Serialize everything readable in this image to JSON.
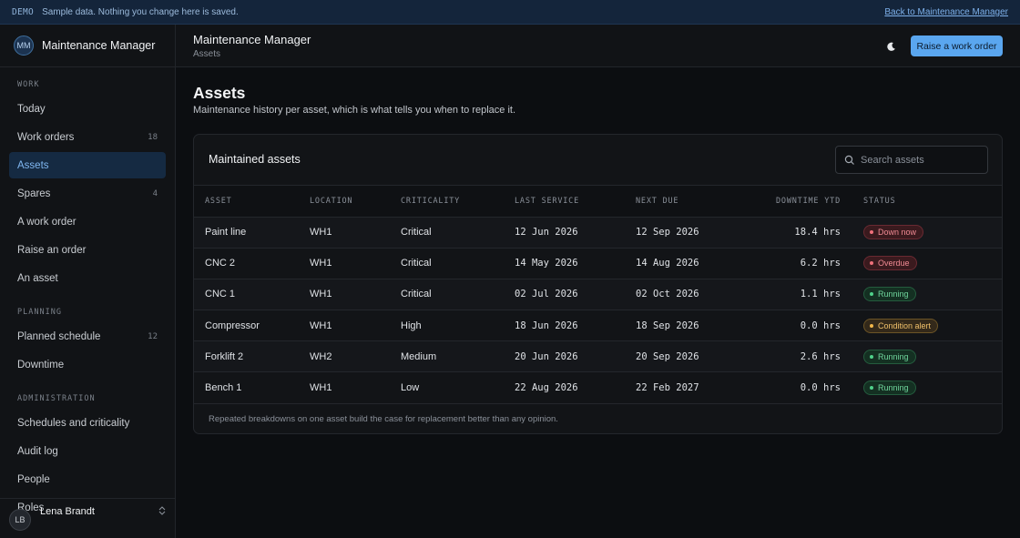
{
  "banner": {
    "tag": "DEMO",
    "message": "Sample data. Nothing you change here is saved.",
    "back_link": "Back to Maintenance Manager"
  },
  "brand": {
    "initials": "MM",
    "name": "Maintenance Manager"
  },
  "sidebar": {
    "sections": [
      {
        "title": "WORK",
        "items": [
          {
            "label": "Today",
            "count": ""
          },
          {
            "label": "Work orders",
            "count": "18"
          },
          {
            "label": "Assets",
            "count": "",
            "active": true
          },
          {
            "label": "Spares",
            "count": "4"
          },
          {
            "label": "A work order",
            "count": ""
          },
          {
            "label": "Raise an order",
            "count": ""
          },
          {
            "label": "An asset",
            "count": ""
          }
        ]
      },
      {
        "title": "PLANNING",
        "items": [
          {
            "label": "Planned schedule",
            "count": "12"
          },
          {
            "label": "Downtime",
            "count": ""
          }
        ]
      },
      {
        "title": "ADMINISTRATION",
        "items": [
          {
            "label": "Schedules and criticality",
            "count": ""
          },
          {
            "label": "Audit log",
            "count": ""
          },
          {
            "label": "People",
            "count": ""
          },
          {
            "label": "Roles",
            "count": ""
          }
        ]
      }
    ]
  },
  "user": {
    "initials": "LB",
    "name": "Lena Brandt"
  },
  "header": {
    "title": "Maintenance Manager",
    "breadcrumb": "Assets",
    "primary_button": "Raise a work order",
    "theme_icon": "moon-icon"
  },
  "page": {
    "title": "Assets",
    "description": "Maintenance history per asset, which is what tells you when to replace it."
  },
  "card": {
    "title": "Maintained assets",
    "search_placeholder": "Search assets",
    "footer": "Repeated breakdowns on one asset build the case for replacement better than any opinion."
  },
  "table": {
    "columns": [
      "ASSET",
      "LOCATION",
      "CRITICALITY",
      "LAST SERVICE",
      "NEXT DUE",
      "DOWNTIME YTD",
      "STATUS"
    ],
    "rows": [
      {
        "asset": "Paint line",
        "location": "WH1",
        "criticality": "Critical",
        "last_service": "12 Jun 2026",
        "next_due": "12 Sep 2026",
        "downtime": "18.4 hrs",
        "status": "Down now",
        "status_kind": "down"
      },
      {
        "asset": "CNC 2",
        "location": "WH1",
        "criticality": "Critical",
        "last_service": "14 May 2026",
        "next_due": "14 Aug 2026",
        "downtime": "6.2 hrs",
        "status": "Overdue",
        "status_kind": "overdue"
      },
      {
        "asset": "CNC 1",
        "location": "WH1",
        "criticality": "Critical",
        "last_service": "02 Jul 2026",
        "next_due": "02 Oct 2026",
        "downtime": "1.1 hrs",
        "status": "Running",
        "status_kind": "running"
      },
      {
        "asset": "Compressor",
        "location": "WH1",
        "criticality": "High",
        "last_service": "18 Jun 2026",
        "next_due": "18 Sep 2026",
        "downtime": "0.0 hrs",
        "status": "Condition alert",
        "status_kind": "alert"
      },
      {
        "asset": "Forklift 2",
        "location": "WH2",
        "criticality": "Medium",
        "last_service": "20 Jun 2026",
        "next_due": "20 Sep 2026",
        "downtime": "2.6 hrs",
        "status": "Running",
        "status_kind": "running"
      },
      {
        "asset": "Bench 1",
        "location": "WH1",
        "criticality": "Low",
        "last_service": "22 Aug 2026",
        "next_due": "22 Feb 2027",
        "downtime": "0.0 hrs",
        "status": "Running",
        "status_kind": "running"
      }
    ]
  },
  "colors": {
    "accent": "#5aa6ef",
    "banner_bg": "#14253b",
    "background": "#0c0e11"
  }
}
